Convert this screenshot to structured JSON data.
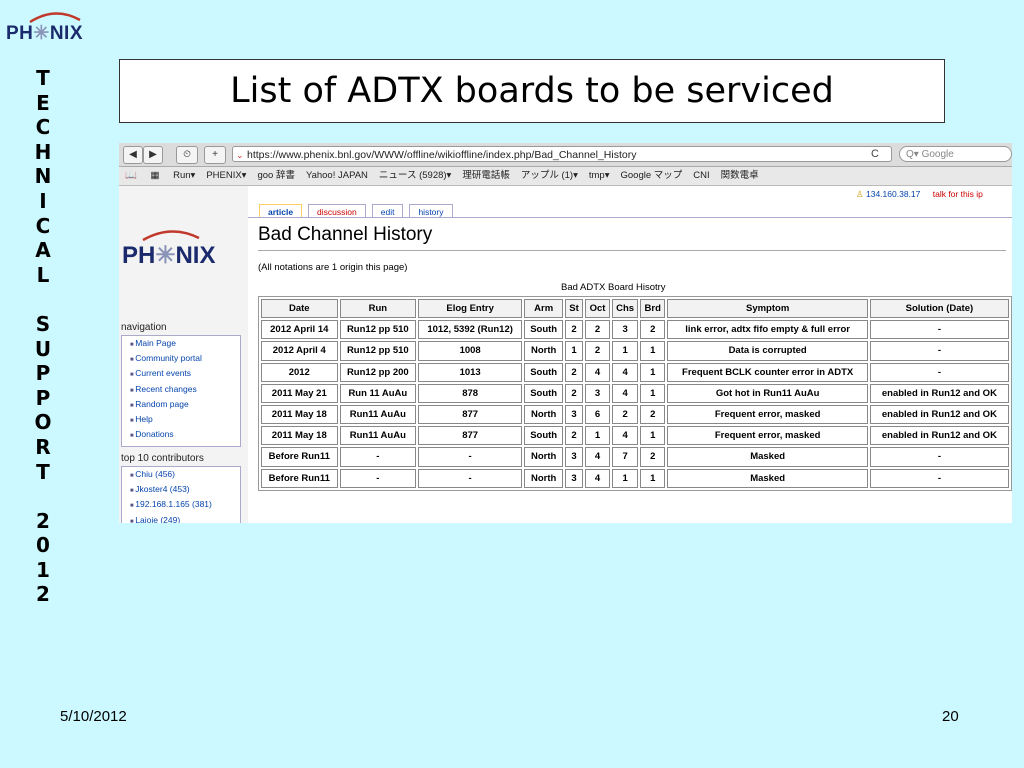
{
  "slide": {
    "logo_text": "PHENIX",
    "vertical_label": [
      "T",
      "E",
      "C",
      "H",
      "N",
      "I",
      "C",
      "A",
      "L",
      "",
      "S",
      "U",
      "P",
      "P",
      "O",
      "R",
      "T",
      "",
      "2",
      "0",
      "1",
      "2"
    ],
    "title": "List of ADTX boards to be serviced",
    "footer_date": "5/10/2012",
    "page_number": "20"
  },
  "browser": {
    "url": "https://www.phenix.bnl.gov/WWW/offline/wikioffline/index.php/Bad_Channel_History",
    "search_placeholder": "Google",
    "back_label": "◀",
    "forward_label": "▶",
    "history_label": "⏲",
    "add_label": "+",
    "reload_label": "C",
    "bookmarks": [
      "Run▾",
      "PHENIX▾",
      "goo 辞書",
      "Yahoo! JAPAN",
      "ニュース (5928)▾",
      "理研電話帳",
      "アップル (1)▾",
      "tmp▾",
      "Google マップ",
      "CNI",
      "関数電卓"
    ]
  },
  "wiki": {
    "logo_text": "PHENIX",
    "user_ip": "134.160.38.17",
    "talk_link": "talk for this ip",
    "tabs": [
      {
        "label": "article",
        "active": true
      },
      {
        "label": "discussion",
        "red": true
      },
      {
        "label": "edit"
      },
      {
        "label": "history"
      }
    ],
    "navigation_heading": "navigation",
    "navigation": [
      "Main Page",
      "Community portal",
      "Current events",
      "Recent changes",
      "Random page",
      "Help",
      "Donations"
    ],
    "contributors_heading": "top 10 contributors",
    "contributors": [
      "Chiu (456)",
      "Jkoster4 (453)",
      "192.168.1.165 (381)",
      "Lajoie (249)"
    ],
    "page_title": "Bad Channel History",
    "notation_note": "(All notations are 1 origin this page)",
    "table_caption": "Bad ADTX Board Hisotry",
    "table": {
      "headers": [
        "Date",
        "Run",
        "Elog Entry",
        "Arm",
        "St",
        "Oct",
        "Chs",
        "Brd",
        "Symptom",
        "Solution (Date)"
      ],
      "rows": [
        [
          "2012 April 14",
          "Run12 pp 510",
          "1012, 5392 (Run12)",
          "South",
          "2",
          "2",
          "3",
          "2",
          "link error, adtx fifo empty & full error",
          "-"
        ],
        [
          "2012 April 4",
          "Run12 pp 510",
          "1008",
          "North",
          "1",
          "2",
          "1",
          "1",
          "Data is corrupted",
          "-"
        ],
        [
          "2012",
          "Run12 pp 200",
          "1013",
          "South",
          "2",
          "4",
          "4",
          "1",
          "Frequent BCLK counter error in ADTX",
          "-"
        ],
        [
          "2011 May 21",
          "Run 11 AuAu",
          "878",
          "South",
          "2",
          "3",
          "4",
          "1",
          "Got hot in Run11 AuAu",
          "enabled in Run12 and OK"
        ],
        [
          "2011 May 18",
          "Run11 AuAu",
          "877",
          "North",
          "3",
          "6",
          "2",
          "2",
          "Frequent error, masked",
          "enabled in Run12 and OK"
        ],
        [
          "2011 May 18",
          "Run11 AuAu",
          "877",
          "South",
          "2",
          "1",
          "4",
          "1",
          "Frequent error, masked",
          "enabled in Run12 and OK"
        ],
        [
          "Before Run11",
          "-",
          "-",
          "North",
          "3",
          "4",
          "7",
          "2",
          "Masked",
          "-"
        ],
        [
          "Before Run11",
          "-",
          "-",
          "North",
          "3",
          "4",
          "1",
          "1",
          "Masked",
          "-"
        ]
      ]
    }
  }
}
